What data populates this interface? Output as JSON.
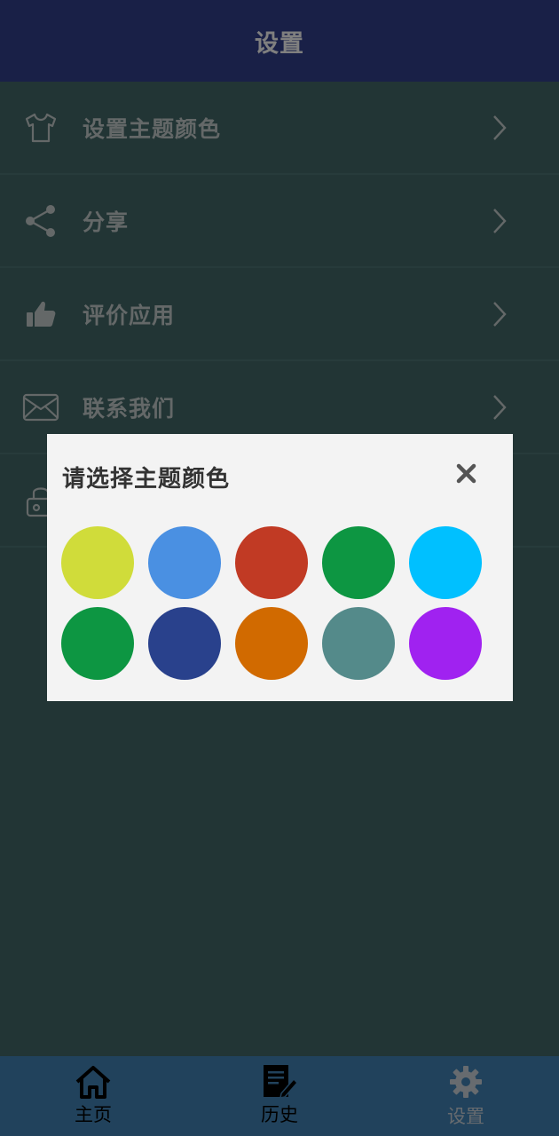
{
  "app_bar": {
    "title": "设置"
  },
  "settings": {
    "items": [
      {
        "label": "设置主题颜色",
        "icon": "tshirt-icon"
      },
      {
        "label": "分享",
        "icon": "share-icon"
      },
      {
        "label": "评价应用",
        "icon": "thumbs-up-icon"
      },
      {
        "label": "联系我们",
        "icon": "mail-icon"
      },
      {
        "label": "",
        "icon": "lock-icon"
      }
    ]
  },
  "dialog": {
    "title": "请选择主题颜色",
    "close_icon": "close-icon",
    "swatches": [
      {
        "color": "#d0dc3a"
      },
      {
        "color": "#4a90e2"
      },
      {
        "color": "#c13a24"
      },
      {
        "color": "#0d9642"
      },
      {
        "color": "#00c0ff"
      },
      {
        "color": "#0d9642"
      },
      {
        "color": "#29418c"
      },
      {
        "color": "#d16a00"
      },
      {
        "color": "#548a8a"
      },
      {
        "color": "#a022f0"
      }
    ]
  },
  "bottom_nav": {
    "items": [
      {
        "label": "主页",
        "icon": "home-icon",
        "active": true
      },
      {
        "label": "历史",
        "icon": "history-edit-icon",
        "active": true
      },
      {
        "label": "设置",
        "icon": "gear-icon",
        "active": false
      }
    ]
  },
  "colors": {
    "app_bar": "#33418f",
    "background": "#446a6a",
    "bottom_nav": "#4385b8",
    "dialog": "#f3f3f3"
  }
}
